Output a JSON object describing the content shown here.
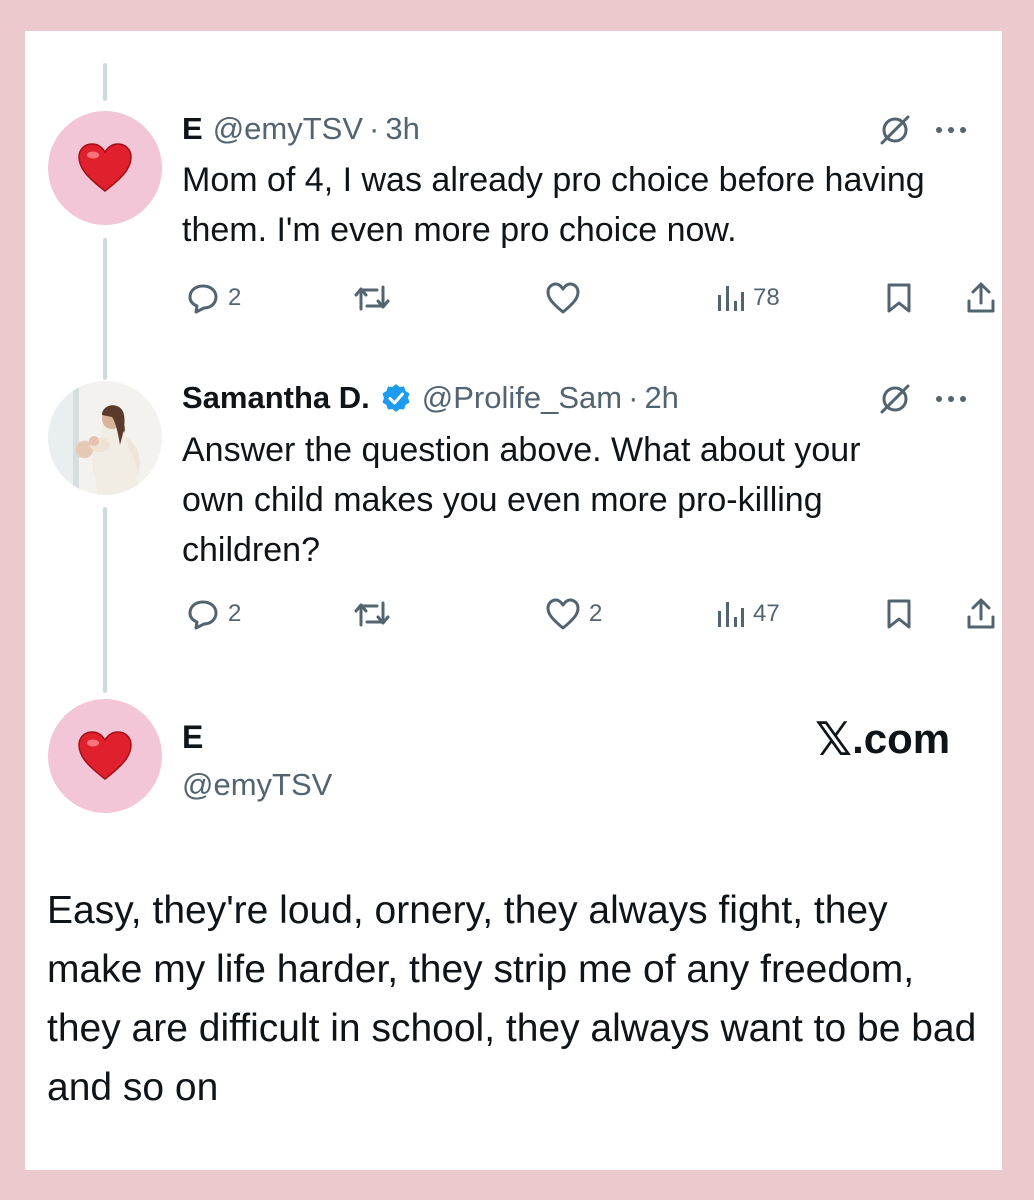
{
  "tweets": [
    {
      "display_name": "E",
      "handle": "@emyTSV",
      "separator": "·",
      "time": "3h",
      "text": "Mom of 4, I was already pro choice before having them. I'm even more pro choice now.",
      "replies": "2",
      "reposts": "",
      "likes": "",
      "views": "78",
      "avatar_icon": "heart-emoji"
    },
    {
      "display_name": "Samantha D.",
      "handle": "@Prolife_Sam",
      "separator": "·",
      "time": "2h",
      "verified": true,
      "text": "Answer the question above. What about your own child makes you even more pro-killing children?",
      "replies": "2",
      "reposts": "",
      "likes": "2",
      "views": "47",
      "avatar_icon": "mother-photo"
    }
  ],
  "main_tweet": {
    "display_name": "E",
    "handle": "@emyTSV",
    "text": "Easy, they're loud, ornery, they always fight, they make my life harder, they strip me of any freedom, they are difficult in school, they always want to be bad and so on",
    "avatar_icon": "heart-emoji"
  },
  "brand": {
    "x": "𝕏",
    "suffix": ".com"
  },
  "colors": {
    "frame": "#ecc9cc",
    "secondary_text": "#536471",
    "verified_blue": "#1d9bf0",
    "avatar_pink": "#f2c6d6",
    "heart_red": "#e0202c"
  }
}
